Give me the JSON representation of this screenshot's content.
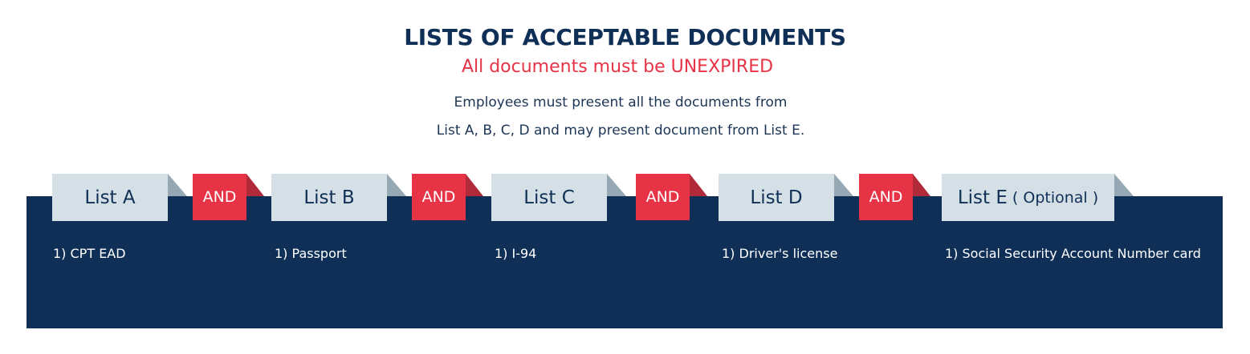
{
  "header": {
    "title": "LISTS OF ACCEPTABLE DOCUMENTS",
    "subtitle": "All documents must be UNEXPIRED",
    "desc_line1": "Employees must present all the documents from",
    "desc_line2": "List A, B, C, D and may present document from List E."
  },
  "connector_label": "AND",
  "lists": [
    {
      "label": "List A",
      "items": [
        "1) CPT EAD"
      ]
    },
    {
      "label": "List B",
      "items": [
        "1) Passport"
      ]
    },
    {
      "label": "List C",
      "items": [
        "1) I-94"
      ]
    },
    {
      "label": "List D",
      "items": [
        "1) Driver's license"
      ]
    },
    {
      "label": "List E",
      "note": "( Optional )",
      "items": [
        "1) Social Security Account Number card"
      ]
    }
  ],
  "colors": {
    "navy": "#0f2f56",
    "red": "#e63346",
    "tab_bg": "#d5e0e6",
    "tab_fold": "#95a8b4",
    "and_fold": "#b02a39"
  }
}
